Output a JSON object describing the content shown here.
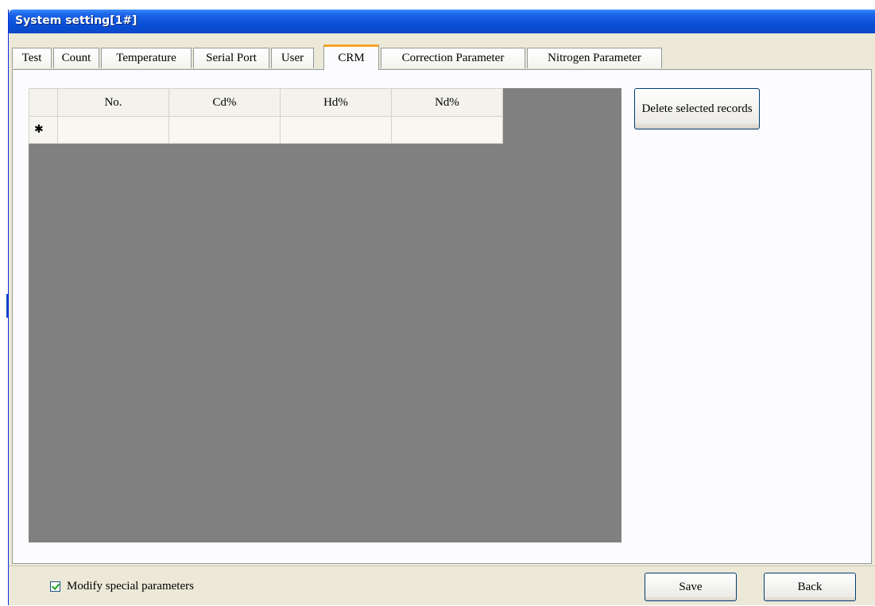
{
  "window": {
    "title": "System setting[1#]"
  },
  "tabs": [
    {
      "label": "Test",
      "active": false
    },
    {
      "label": "Count",
      "active": false
    },
    {
      "label": "Temperature",
      "active": false
    },
    {
      "label": "Serial Port",
      "active": false
    },
    {
      "label": "User",
      "active": false
    },
    {
      "label": "CRM",
      "active": true
    },
    {
      "label": "Correction Parameter",
      "active": false
    },
    {
      "label": "Nitrogen Parameter",
      "active": false
    }
  ],
  "grid": {
    "columns": [
      "No.",
      "Cd%",
      "Hd%",
      "Nd%"
    ],
    "new_row_marker": "✱",
    "rows": []
  },
  "actions": {
    "delete_label": "Delete selected records"
  },
  "footer": {
    "modify_label": "Modify special parameters",
    "modify_checked": true,
    "save_label": "Save",
    "back_label": "Back"
  },
  "colors": {
    "titlebar": "#0a50d8",
    "grid_background": "#808080",
    "active_tab_accent": "#f5a623"
  }
}
